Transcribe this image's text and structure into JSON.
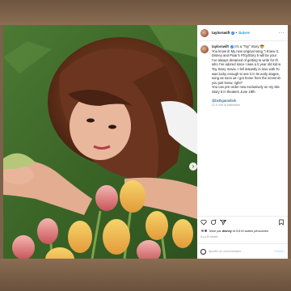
{
  "post": {
    "username": "taylorswift",
    "follow_label": "Suivre",
    "caption_lines": [
      "It’s a “Toy” Story 🤠",
      "You know it! My new original song “I Knew It,",
      "Disney and Pixar’s #ToyStory 5 will be your",
      "I’ve always dreamed of getting to write for th",
      "who I’ve adored since I was a 5 year old kid w",
      "Toy Story movie. I fell instantly in love with To",
      "was lucky enough to see it in its early stages,",
      "song as soon as I got home from the screenin",
      "you just know, right?",
      "You can pre-order now exclusively on my site",
      "Story 5 in theaters June 19th"
    ],
    "mention": "@bethgaranfark",
    "time_ago": "21 h",
    "translation_label": "Voir la traduction",
    "likes_text": "Aimé par",
    "likes_user": "disney",
    "likes_count": "et 5,8 M autres personnes",
    "date": "Il y a 21 heures",
    "comment_placeholder": "Ajouter un commentaire...",
    "publish_label": "Publier"
  },
  "icons": {
    "more": "more-horizontal-icon",
    "like": "heart-icon",
    "comment": "comment-icon",
    "share": "share-icon",
    "save": "bookmark-icon",
    "next": "chevron-right-icon",
    "emoji": "emoji-icon"
  },
  "colors": {
    "accent": "#0095f6",
    "link": "#00376b",
    "verified": "#2f8ff0"
  }
}
